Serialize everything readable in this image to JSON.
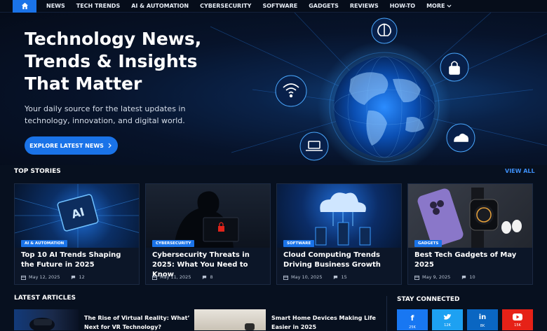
{
  "nav": {
    "items": [
      "NEWS",
      "TECH TRENDS",
      "AI & AUTOMATION",
      "CYBERSECURITY",
      "SOFTWARE",
      "GADGETS",
      "REVIEWS",
      "HOW-TO",
      "MORE"
    ]
  },
  "hero": {
    "title": "Technology News, Trends & Insights That Matter",
    "subtitle": "Your daily source for the latest updates in technology, innovation, and digital world.",
    "cta_label": "EXPLORE LATEST NEWS"
  },
  "top_stories": {
    "heading": "TOP STORIES",
    "view_all": "VIEW ALL",
    "cards": [
      {
        "badge": "AI & AUTOMATION",
        "title": "Top 10 AI Trends Shaping the Future in 2025",
        "date": "May 12, 2025",
        "comments": "12"
      },
      {
        "badge": "CYBERSECURITY",
        "title": "Cybersecurity Threats in 2025: What You Need to Know",
        "date": "May 11, 2025",
        "comments": "8"
      },
      {
        "badge": "SOFTWARE",
        "title": "Cloud Computing Trends Driving Business Growth",
        "date": "May 10, 2025",
        "comments": "15"
      },
      {
        "badge": "GADGETS",
        "title": "Best Tech Gadgets of May 2025",
        "date": "May 9, 2025",
        "comments": "10"
      }
    ],
    "image_text": {
      "ai_chip": "AI"
    }
  },
  "latest": {
    "heading": "LATEST ARTICLES",
    "articles": [
      {
        "title": "The Rise of Virtual Reality: What’s Next for VR Technology?"
      },
      {
        "title": "Smart Home Devices Making Life Easier in 2025"
      }
    ]
  },
  "stay_connected": {
    "heading": "STAY CONNECTED",
    "networks": [
      {
        "icon": "facebook-icon",
        "glyph": "f",
        "count": "25K",
        "color": "#1877f2"
      },
      {
        "icon": "twitter-icon",
        "glyph": "t",
        "count": "12K",
        "color": "#1da1f2"
      },
      {
        "icon": "linkedin-icon",
        "glyph": "in",
        "count": "8K",
        "color": "#0a66c2"
      },
      {
        "icon": "youtube-icon",
        "glyph": "▶",
        "count": "15K",
        "color": "#e62117"
      }
    ]
  },
  "colors": {
    "accent": "#1a73e8",
    "background": "#07101f",
    "card": "#0c1628"
  }
}
